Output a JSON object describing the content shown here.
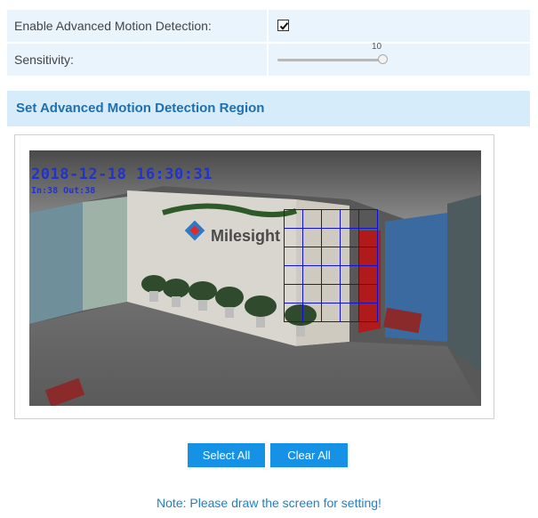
{
  "settings": {
    "enable_label": "Enable Advanced Motion Detection:",
    "enable_checked": true,
    "sensitivity_label": "Sensitivity:",
    "sensitivity_value": "10",
    "sensitivity_fraction": 1.0
  },
  "region": {
    "title": "Set Advanced Motion Detection Region",
    "osd_time": "2018-12-18  16:30:31",
    "osd_counts": "In:38  Out:38",
    "logo_text": "Milesight",
    "grid_cols": 5,
    "grid_rows": 6
  },
  "buttons": {
    "select_all": "Select All",
    "clear_all": "Clear All"
  },
  "note": "Note: Please draw the screen for setting!",
  "colors": {
    "accent": "#1592e6",
    "header_bg": "#d6ecfa",
    "row_bg": "#eaf4fd",
    "grid": "#1010d8",
    "osd": "#2233cc"
  }
}
